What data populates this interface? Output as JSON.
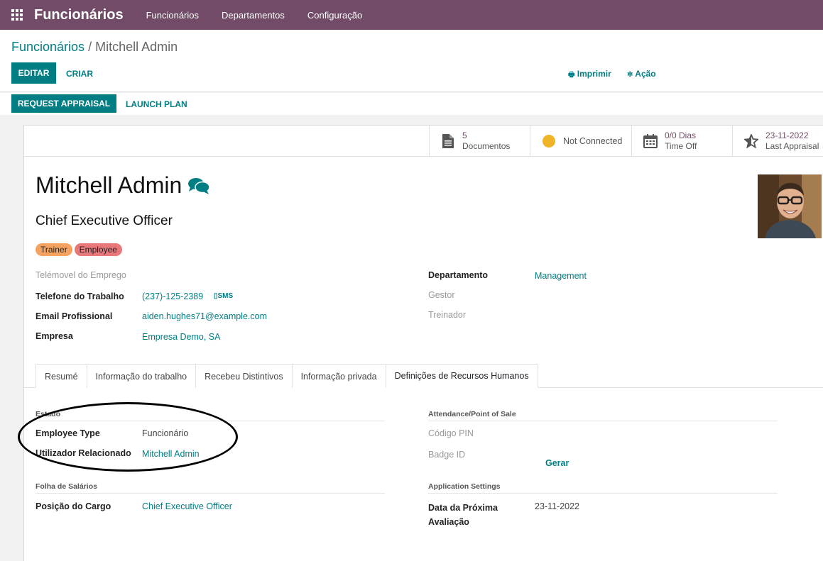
{
  "navbar": {
    "brand": "Funcionários",
    "menu": [
      "Funcionários",
      "Departamentos",
      "Configuração"
    ]
  },
  "breadcrumb": {
    "parent": "Funcionários",
    "separator": " / ",
    "current": "Mitchell Admin"
  },
  "buttons": {
    "edit": "EDITAR",
    "create": "CRIAR",
    "print": "Imprimir",
    "action": "Ação",
    "request_appraisal": "REQUEST APPRAISAL",
    "launch_plan": "LAUNCH PLAN",
    "generate": "Gerar"
  },
  "smart_buttons": {
    "documents": {
      "value": "5",
      "label": "Documentos"
    },
    "presence": {
      "label": "Not Connected",
      "color": "#f0b429"
    },
    "time_off": {
      "value": "0/0 Dias",
      "label": "Time Off"
    },
    "appraisal": {
      "value": "23-11-2022",
      "label": "Last Appraisal"
    }
  },
  "employee": {
    "name": "Mitchell Admin",
    "job_title": "Chief Executive Officer",
    "tags": [
      {
        "label": "Trainer",
        "color": "#f4a460"
      },
      {
        "label": "Employee",
        "color": "#e9787a"
      }
    ]
  },
  "fields_left": {
    "mobile_label": "Telémovel do Emprego",
    "work_phone_label": "Telefone do Trabalho",
    "work_phone_value": "(237)-125-2389",
    "sms_label": "SMS",
    "email_label": "Email Profissional",
    "email_value": "aiden.hughes71@example.com",
    "company_label": "Empresa",
    "company_value": "Empresa Demo, SA"
  },
  "fields_right": {
    "department_label": "Departamento",
    "department_value": "Management",
    "manager_label": "Gestor",
    "coach_label": "Treinador"
  },
  "tabs": [
    "Resumé",
    "Informação do trabalho",
    "Recebeu Distintivos",
    "Informação privada",
    "Definições de Recursos Humanos"
  ],
  "hr_settings": {
    "status_title": "Estado",
    "employee_type_label": "Employee Type",
    "employee_type_value": "Funcionário",
    "related_user_label": "Utilizador Relacionado",
    "related_user_value": "Mitchell Admin",
    "payroll_title": "Folha de Salários",
    "job_position_label": "Posição do Cargo",
    "job_position_value": "Chief Executive Officer",
    "attendance_title": "Attendance/Point of Sale",
    "pin_label": "Código PIN",
    "badge_label": "Badge ID",
    "app_settings_title": "Application Settings",
    "next_appraisal_label_1": "Data da Próxima",
    "next_appraisal_label_2": "Avaliação",
    "next_appraisal_value": "23-11-2022"
  },
  "colors": {
    "navbar": "#714B67",
    "primary": "#017e84"
  }
}
